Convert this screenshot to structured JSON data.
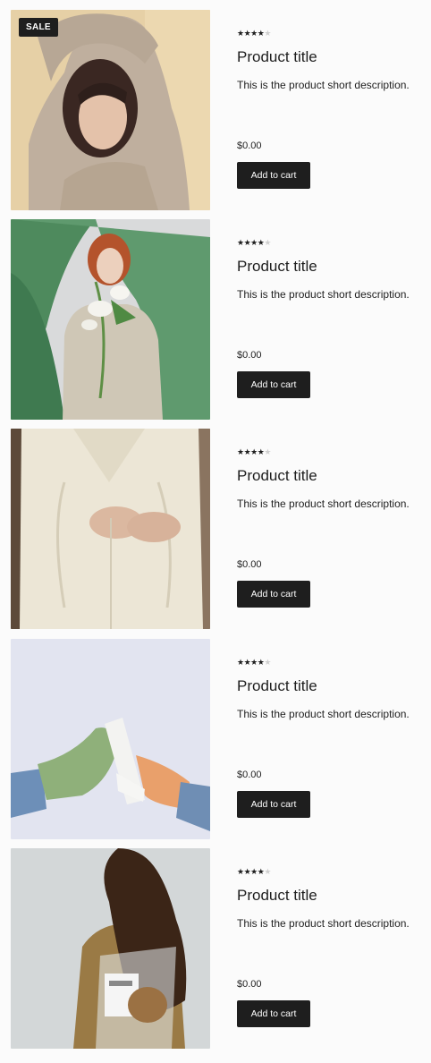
{
  "products": [
    {
      "badge": "SALE",
      "rating": 4,
      "rating_max": 5,
      "title": "Product title",
      "description": "This is the product short description.",
      "price": "$0.00",
      "cart_label": "Add to cart"
    },
    {
      "rating": 4,
      "rating_max": 5,
      "title": "Product title",
      "description": "This is the product short description.",
      "price": "$0.00",
      "cart_label": "Add to cart"
    },
    {
      "rating": 4,
      "rating_max": 5,
      "title": "Product title",
      "description": "This is the product short description.",
      "price": "$0.00",
      "cart_label": "Add to cart"
    },
    {
      "rating": 4,
      "rating_max": 5,
      "title": "Product title",
      "description": "This is the product short description.",
      "price": "$0.00",
      "cart_label": "Add to cart"
    },
    {
      "rating": 4,
      "rating_max": 5,
      "title": "Product title",
      "description": "This is the product short description.",
      "price": "$0.00",
      "cart_label": "Add to cart"
    }
  ]
}
